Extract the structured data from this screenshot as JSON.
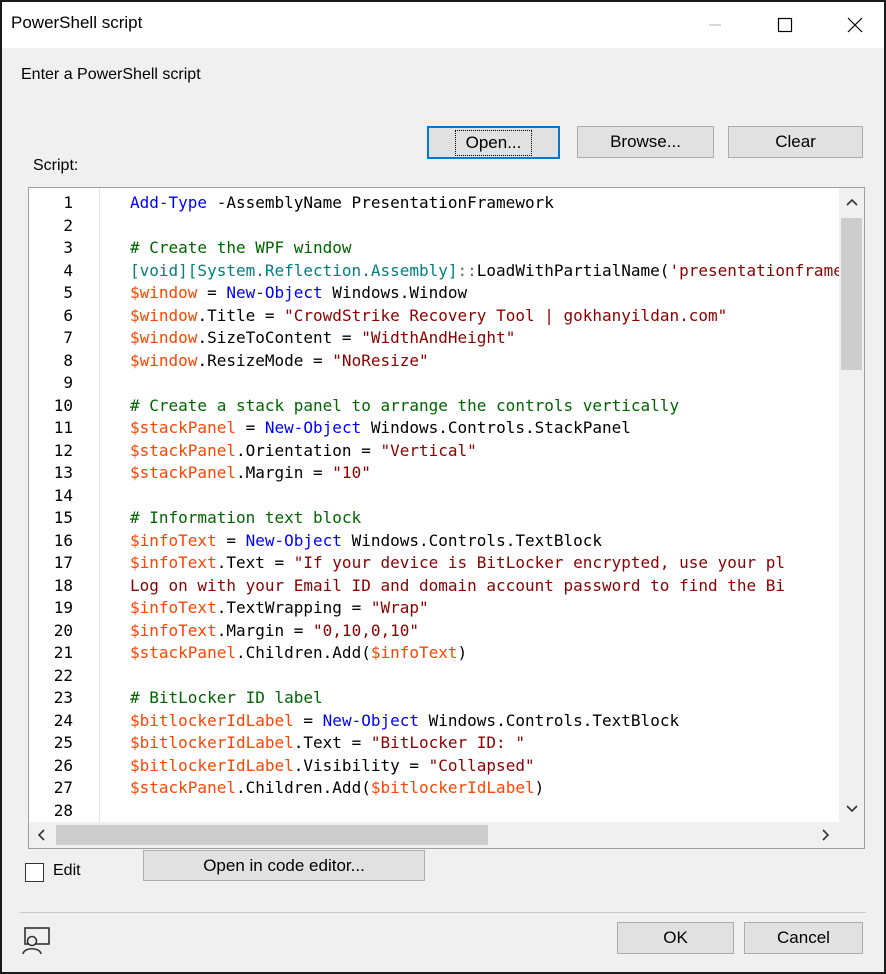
{
  "window": {
    "title": "PowerShell script"
  },
  "dialog": {
    "prompt": "Enter a PowerShell script",
    "open_label": "Open...",
    "browse_label": "Browse...",
    "clear_label": "Clear",
    "script_label": "Script:",
    "edit_label": "Edit",
    "edit_checked": false,
    "open_code_editor_label": "Open in code editor...",
    "ok_label": "OK",
    "cancel_label": "Cancel"
  },
  "colors": {
    "accent": "#0078d7",
    "cmdlet": "#0000ff",
    "variable": "#ff4500",
    "string": "#8b0000",
    "comment": "#006400",
    "type": "#008080"
  },
  "editor": {
    "lines": [
      {
        "n": "1",
        "tokens": [
          {
            "t": "cmd",
            "v": "Add-Type"
          },
          {
            "t": "txt",
            "v": " -AssemblyName PresentationFramework"
          }
        ]
      },
      {
        "n": "2",
        "tokens": []
      },
      {
        "n": "3",
        "tokens": [
          {
            "t": "cmt",
            "v": "# Create the WPF window"
          }
        ]
      },
      {
        "n": "4",
        "tokens": [
          {
            "t": "typ",
            "v": "[void][System.Reflection.Assembly]"
          },
          {
            "t": "pun",
            "v": "::"
          },
          {
            "t": "txt",
            "v": "LoadWithPartialName("
          },
          {
            "t": "str",
            "v": "'presentationframework'"
          }
        ]
      },
      {
        "n": "5",
        "tokens": [
          {
            "t": "var",
            "v": "$window"
          },
          {
            "t": "txt",
            "v": " = "
          },
          {
            "t": "cmd",
            "v": "New-Object"
          },
          {
            "t": "txt",
            "v": " Windows.Window"
          }
        ]
      },
      {
        "n": "6",
        "tokens": [
          {
            "t": "var",
            "v": "$window"
          },
          {
            "t": "txt",
            "v": ".Title = "
          },
          {
            "t": "str",
            "v": "\"CrowdStrike Recovery Tool | gokhanyildan.com\""
          }
        ]
      },
      {
        "n": "7",
        "tokens": [
          {
            "t": "var",
            "v": "$window"
          },
          {
            "t": "txt",
            "v": ".SizeToContent = "
          },
          {
            "t": "str",
            "v": "\"WidthAndHeight\""
          }
        ]
      },
      {
        "n": "8",
        "tokens": [
          {
            "t": "var",
            "v": "$window"
          },
          {
            "t": "txt",
            "v": ".ResizeMode = "
          },
          {
            "t": "str",
            "v": "\"NoResize\""
          }
        ]
      },
      {
        "n": "9",
        "tokens": []
      },
      {
        "n": "10",
        "tokens": [
          {
            "t": "cmt",
            "v": "# Create a stack panel to arrange the controls vertically"
          }
        ]
      },
      {
        "n": "11",
        "tokens": [
          {
            "t": "var",
            "v": "$stackPanel"
          },
          {
            "t": "txt",
            "v": " = "
          },
          {
            "t": "cmd",
            "v": "New-Object"
          },
          {
            "t": "txt",
            "v": " Windows.Controls.StackPanel"
          }
        ]
      },
      {
        "n": "12",
        "tokens": [
          {
            "t": "var",
            "v": "$stackPanel"
          },
          {
            "t": "txt",
            "v": ".Orientation = "
          },
          {
            "t": "str",
            "v": "\"Vertical\""
          }
        ]
      },
      {
        "n": "13",
        "tokens": [
          {
            "t": "var",
            "v": "$stackPanel"
          },
          {
            "t": "txt",
            "v": ".Margin = "
          },
          {
            "t": "str",
            "v": "\"10\""
          }
        ]
      },
      {
        "n": "14",
        "tokens": []
      },
      {
        "n": "15",
        "tokens": [
          {
            "t": "cmt",
            "v": "# Information text block"
          }
        ]
      },
      {
        "n": "16",
        "tokens": [
          {
            "t": "var",
            "v": "$infoText"
          },
          {
            "t": "txt",
            "v": " = "
          },
          {
            "t": "cmd",
            "v": "New-Object"
          },
          {
            "t": "txt",
            "v": " Windows.Controls.TextBlock"
          }
        ]
      },
      {
        "n": "17",
        "tokens": [
          {
            "t": "var",
            "v": "$infoText"
          },
          {
            "t": "txt",
            "v": ".Text = "
          },
          {
            "t": "str",
            "v": "\"If your device is BitLocker encrypted, use your pl"
          }
        ]
      },
      {
        "n": "18",
        "tokens": [
          {
            "t": "str",
            "v": "Log on with your Email ID and domain account password to find the Bi"
          }
        ]
      },
      {
        "n": "19",
        "tokens": [
          {
            "t": "var",
            "v": "$infoText"
          },
          {
            "t": "txt",
            "v": ".TextWrapping = "
          },
          {
            "t": "str",
            "v": "\"Wrap\""
          }
        ]
      },
      {
        "n": "20",
        "tokens": [
          {
            "t": "var",
            "v": "$infoText"
          },
          {
            "t": "txt",
            "v": ".Margin = "
          },
          {
            "t": "str",
            "v": "\"0,10,0,10\""
          }
        ]
      },
      {
        "n": "21",
        "tokens": [
          {
            "t": "var",
            "v": "$stackPanel"
          },
          {
            "t": "txt",
            "v": ".Children.Add("
          },
          {
            "t": "var",
            "v": "$infoText"
          },
          {
            "t": "txt",
            "v": ")"
          }
        ]
      },
      {
        "n": "22",
        "tokens": []
      },
      {
        "n": "23",
        "tokens": [
          {
            "t": "cmt",
            "v": "# BitLocker ID label"
          }
        ]
      },
      {
        "n": "24",
        "tokens": [
          {
            "t": "var",
            "v": "$bitlockerIdLabel"
          },
          {
            "t": "txt",
            "v": " = "
          },
          {
            "t": "cmd",
            "v": "New-Object"
          },
          {
            "t": "txt",
            "v": " Windows.Controls.TextBlock"
          }
        ]
      },
      {
        "n": "25",
        "tokens": [
          {
            "t": "var",
            "v": "$bitlockerIdLabel"
          },
          {
            "t": "txt",
            "v": ".Text = "
          },
          {
            "t": "str",
            "v": "\"BitLocker ID: \""
          }
        ]
      },
      {
        "n": "26",
        "tokens": [
          {
            "t": "var",
            "v": "$bitlockerIdLabel"
          },
          {
            "t": "txt",
            "v": ".Visibility = "
          },
          {
            "t": "str",
            "v": "\"Collapsed\""
          }
        ]
      },
      {
        "n": "27",
        "tokens": [
          {
            "t": "var",
            "v": "$stackPanel"
          },
          {
            "t": "txt",
            "v": ".Children.Add("
          },
          {
            "t": "var",
            "v": "$bitlockerIdLabel"
          },
          {
            "t": "txt",
            "v": ")"
          }
        ]
      },
      {
        "n": "28",
        "tokens": []
      }
    ]
  },
  "icons": {
    "minimize": "minimize-icon",
    "maximize": "maximize-icon",
    "close": "close-icon",
    "footer": "user-screen-icon"
  }
}
